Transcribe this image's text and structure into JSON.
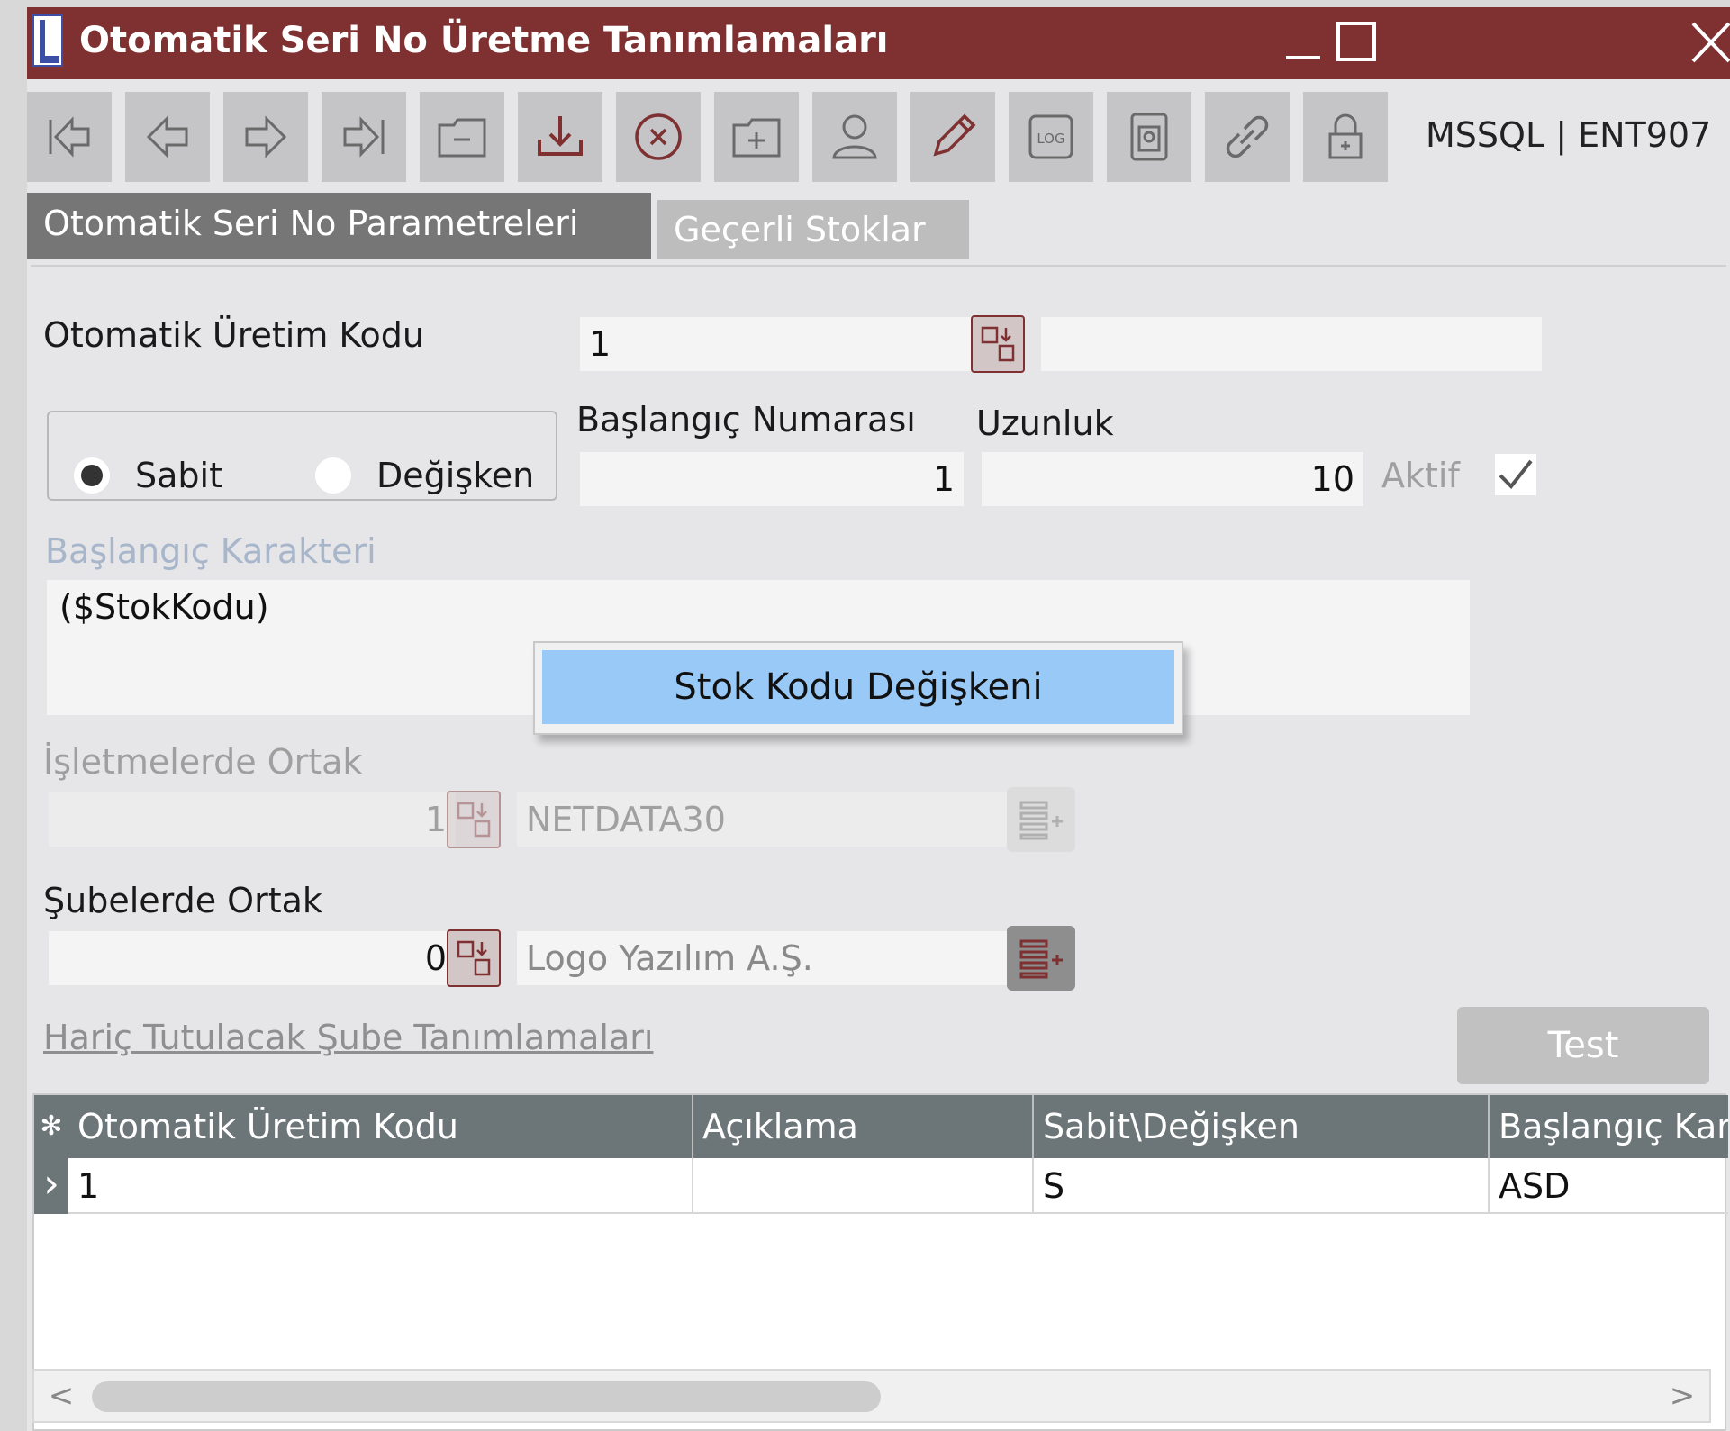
{
  "window": {
    "title": "Otomatik Seri No Üretme Tanımlamaları",
    "logo_letter": "L",
    "minimize_label": "_",
    "accent_color": "#7f3132"
  },
  "toolbar": {
    "buttons": [
      {
        "icon": "first-record-icon"
      },
      {
        "icon": "previous-record-icon"
      },
      {
        "icon": "next-record-icon"
      },
      {
        "icon": "last-record-icon"
      },
      {
        "icon": "new-record-icon"
      },
      {
        "icon": "save-icon"
      },
      {
        "icon": "delete-icon"
      },
      {
        "icon": "add-folder-icon"
      },
      {
        "icon": "user-icon"
      },
      {
        "icon": "edit-icon"
      },
      {
        "icon": "log-icon"
      },
      {
        "icon": "document-icon"
      },
      {
        "icon": "link-icon"
      },
      {
        "icon": "lock-icon"
      }
    ],
    "server_info": "MSSQL | ENT907"
  },
  "tabs": [
    {
      "label": "Otomatik Seri No Parametreleri",
      "active": true
    },
    {
      "label": "Geçerli Stoklar",
      "active": false
    }
  ],
  "form": {
    "uretim_kodu_label": "Otomatik Üretim Kodu",
    "uretim_kodu_value": "1",
    "uretim_kodu_desc": "",
    "radio_sabit": "Sabit",
    "radio_degisken": "Değişken",
    "radio_selected": "Sabit",
    "baslangic_numarasi_label": "Başlangıç Numarası",
    "baslangic_numarasi_value": "1",
    "uzunluk_label": "Uzunluk",
    "uzunluk_value": "10",
    "aktif_label": "Aktif",
    "aktif_checked": true,
    "baslangic_karakteri_label": "Başlangıç Karakteri",
    "baslangic_karakteri_value": "($StokKodu)",
    "isletmelerde_ortak_label": "İşletmelerde Ortak",
    "isletme_no": "1",
    "isletme_name": "NETDATA30",
    "subelerde_ortak_label": "Şubelerde Ortak",
    "sube_no": "0",
    "sube_name": "Logo Yazılım A.Ş.",
    "haric_link": "Hariç Tutulacak Şube Tanımlamaları",
    "test_button": "Test"
  },
  "context_menu": {
    "items": [
      "Stok Kodu Değişkeni"
    ]
  },
  "grid": {
    "columns": [
      "Otomatik Üretim Kodu",
      "Açıklama",
      "Sabit\\Değişken",
      "Başlangıç Karakteri"
    ],
    "rows": [
      [
        "1",
        "",
        "S",
        "ASD"
      ]
    ],
    "new_row_marker": "✻",
    "current_row_marker": "›"
  },
  "scrollbar": {
    "left_arrow": "<",
    "right_arrow": ">"
  }
}
